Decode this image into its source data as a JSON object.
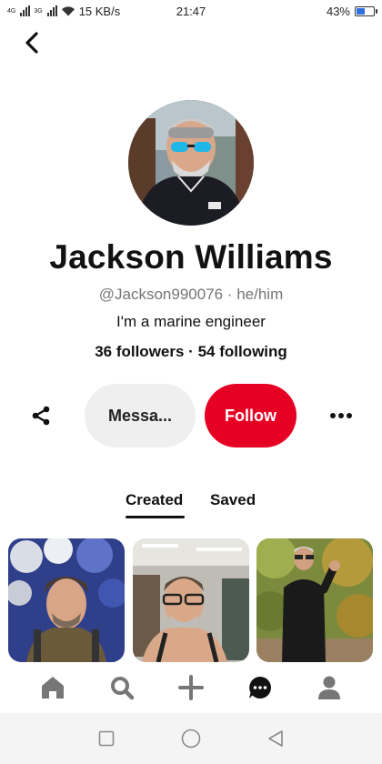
{
  "status_bar": {
    "network_label_1": "4G",
    "network_label_2": "3G",
    "speed": "15 KB/s",
    "time": "21:47",
    "battery_percent": "43%",
    "battery_level": 0.43
  },
  "profile": {
    "name": "Jackson Williams",
    "handle": "@Jackson990076",
    "pronouns": "he/him",
    "separator": " · ",
    "bio": "I'm a marine engineer",
    "followers": "36 followers",
    "following": "54 following"
  },
  "actions": {
    "message_label": "Messa...",
    "follow_label": "Follow"
  },
  "tabs": [
    {
      "label": "Created",
      "active": true
    },
    {
      "label": "Saved",
      "active": false
    }
  ],
  "bottom_nav": {
    "items": [
      "home-icon",
      "search-icon",
      "plus-icon",
      "chat-icon",
      "profile-icon"
    ]
  },
  "colors": {
    "accent": "#e60023",
    "button_gray": "#efefef",
    "secondary_text": "#767676"
  }
}
